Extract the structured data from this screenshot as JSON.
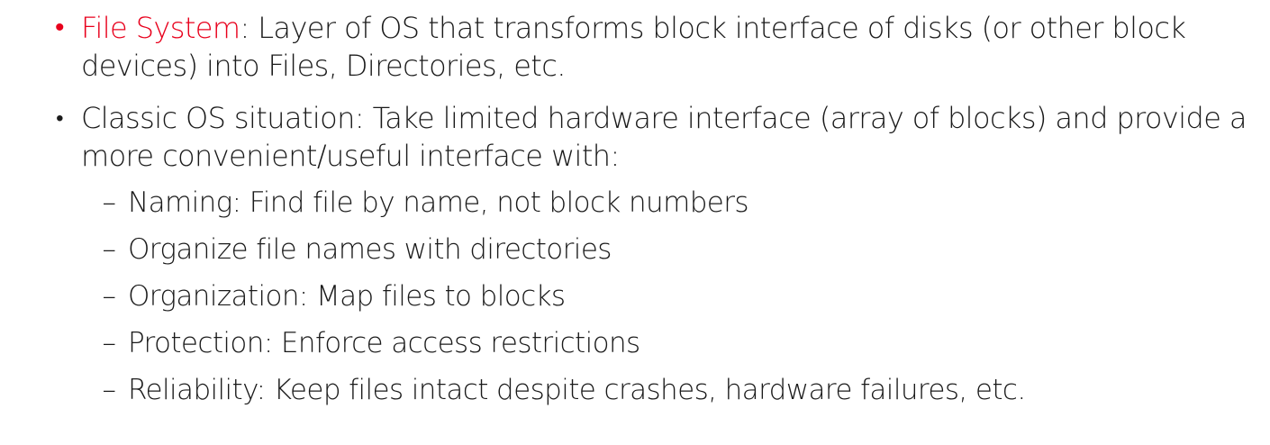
{
  "bullets": [
    {
      "marker": "•",
      "term": "File System",
      "text": ": Layer of OS that transforms block interface of disks (or other block devices) into Files, Directories, etc."
    },
    {
      "marker": "•",
      "text": "Classic OS situation: Take limited hardware interface (array of blocks) and provide a more convenient/useful interface with:",
      "subitems": [
        {
          "marker": "–",
          "text": "Naming: Find file by name, not block numbers"
        },
        {
          "marker": "–",
          "text": "Organize file names with directories"
        },
        {
          "marker": "–",
          "text": "Organization: Map files to blocks"
        },
        {
          "marker": "–",
          "text": "Protection: Enforce access restrictions"
        },
        {
          "marker": "–",
          "text": "Reliability: Keep files intact despite crashes, hardware failures, etc."
        }
      ]
    }
  ],
  "colors": {
    "accent": "#e8001c",
    "text": "#1a1a1a",
    "background": "#ffffff"
  }
}
